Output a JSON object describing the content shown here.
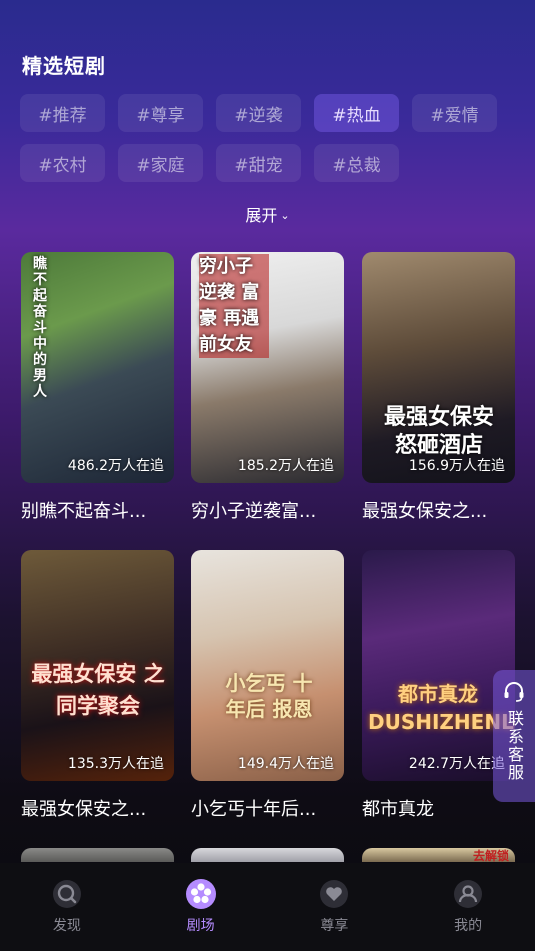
{
  "section": {
    "title": "精选短剧"
  },
  "tags": [
    {
      "label": "#推荐",
      "active": false
    },
    {
      "label": "#尊享",
      "active": false
    },
    {
      "label": "#逆袭",
      "active": false
    },
    {
      "label": "#热血",
      "active": true
    },
    {
      "label": "#爱情",
      "active": false
    },
    {
      "label": "#农村",
      "active": false
    },
    {
      "label": "#家庭",
      "active": false
    },
    {
      "label": "#甜宠",
      "active": false
    },
    {
      "label": "#总裁",
      "active": false
    }
  ],
  "expand": {
    "label": "展开"
  },
  "dramas": [
    {
      "title": "别瞧不起奋斗...",
      "count": "486.2万人在追",
      "poster_text": "瞧不起奋斗中的男人"
    },
    {
      "title": "穷小子逆袭富...",
      "count": "185.2万人在追",
      "poster_text": "穷小子 逆袭 富豪 再遇前女友"
    },
    {
      "title": "最强女保安之...",
      "count": "156.9万人在追",
      "poster_text": "最强女保安 怒砸酒店"
    },
    {
      "title": "最强女保安之...",
      "count": "135.3万人在追",
      "poster_text": "最强女保安 之同学聚会"
    },
    {
      "title": "小乞丐十年后...",
      "count": "149.4万人在追",
      "poster_text": "小乞丐 十年后 报恩"
    },
    {
      "title": "都市真龙",
      "count": "242.7万人在追",
      "poster_text": "都市真龙 DUSHIZHENLONG"
    }
  ],
  "partial_row_badge": "去解锁",
  "customer_service": {
    "label": "联系客服"
  },
  "tabbar": [
    {
      "label": "发现",
      "icon": "discover-icon",
      "active": false
    },
    {
      "label": "剧场",
      "icon": "theater-icon",
      "active": true
    },
    {
      "label": "尊享",
      "icon": "vip-heart-icon",
      "active": false
    },
    {
      "label": "我的",
      "icon": "profile-icon",
      "active": false
    }
  ],
  "colors": {
    "accent": "#b58cff",
    "active_tag_bg": "#6a52c8",
    "cs_bg": "#7a5adc"
  }
}
